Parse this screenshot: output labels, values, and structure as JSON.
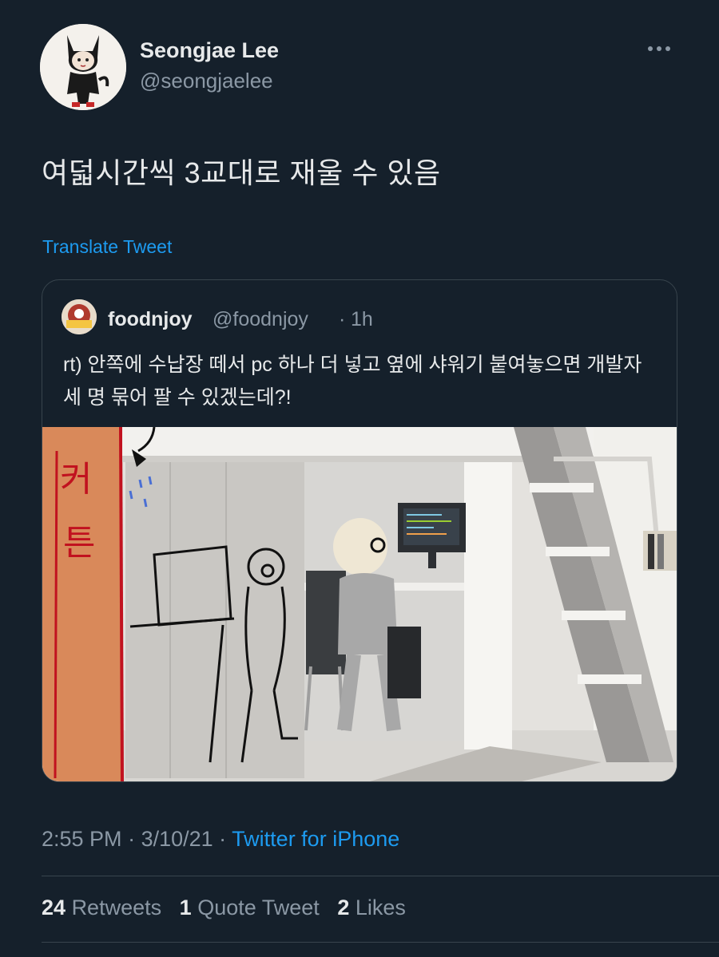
{
  "author": {
    "name": "Seongjae Lee",
    "handle": "@seongjaelee",
    "avatar_icon": "black-cat-character-avatar"
  },
  "more_icon": "more-horizontal-icon",
  "tweet": {
    "text": "여덟시간씩 3교대로 재울 수 있음",
    "translate_label": "Translate Tweet"
  },
  "quote": {
    "name": "foodnjoy",
    "handle": "@foodnjoy",
    "separator": "·",
    "time": "1h",
    "text": "rt) 안쪽에 수납장 떼서 pc 하나 더 넣고 옆에 샤워기 붙여놓으면 개발자 세 명 묶어 팔 수 있겠는데?!",
    "image": {
      "curtain_label_line1": "커",
      "curtain_label_line2": "튼"
    }
  },
  "meta": {
    "time": "2:55 PM",
    "separator1": " · ",
    "date": "3/10/21",
    "separator2": " · ",
    "source": "Twitter for iPhone"
  },
  "stats": {
    "retweets_count": "24",
    "retweets_label": "Retweets",
    "quote_count": "1",
    "quote_label": "Quote Tweet",
    "likes_count": "2",
    "likes_label": "Likes"
  },
  "colors": {
    "background": "#15202b",
    "link": "#1d9bf0",
    "secondary_text": "#8b98a5",
    "border": "#38444d"
  }
}
